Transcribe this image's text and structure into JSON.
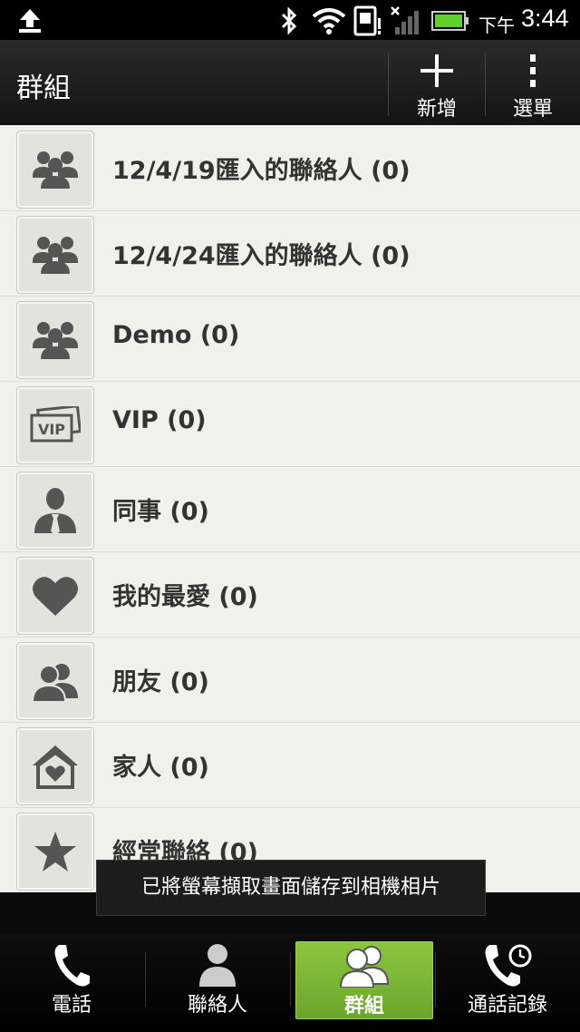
{
  "status_bar": {
    "ampm": "下午",
    "time": "3:44",
    "icons": [
      "upload-icon",
      "bluetooth-icon",
      "wifi-icon",
      "sim-icon",
      "signal-icon",
      "battery-icon"
    ]
  },
  "action_bar": {
    "title": "群組",
    "add_label": "新增",
    "menu_label": "選單"
  },
  "groups": [
    {
      "name": "12/4/19匯入的聯絡人",
      "count": "(0)",
      "icon": "group-icon"
    },
    {
      "name": "12/4/24匯入的聯絡人",
      "count": "(0)",
      "icon": "group-icon"
    },
    {
      "name": "Demo",
      "count": "(0)",
      "icon": "group-icon"
    },
    {
      "name": "VIP",
      "count": "(0)",
      "icon": "vip-icon"
    },
    {
      "name": "同事",
      "count": "(0)",
      "icon": "coworker-icon"
    },
    {
      "name": "我的最愛",
      "count": "(0)",
      "icon": "heart-icon"
    },
    {
      "name": "朋友",
      "count": "(0)",
      "icon": "friends-icon"
    },
    {
      "name": "家人",
      "count": "(0)",
      "icon": "home-icon"
    },
    {
      "name": "經常聯絡",
      "count": "(0)",
      "icon": "star-icon"
    }
  ],
  "toast": "已將螢幕擷取畫面儲存到相機相片",
  "tabs": [
    {
      "label": "電話",
      "icon": "phone-icon"
    },
    {
      "label": "聯絡人",
      "icon": "person-icon"
    },
    {
      "label": "群組",
      "icon": "group-icon",
      "active": true
    },
    {
      "label": "通話記錄",
      "icon": "call-history-icon"
    }
  ],
  "colors": {
    "active_tab": "#7ab833",
    "list_bg": "#f1f1ec",
    "text": "#333333"
  }
}
